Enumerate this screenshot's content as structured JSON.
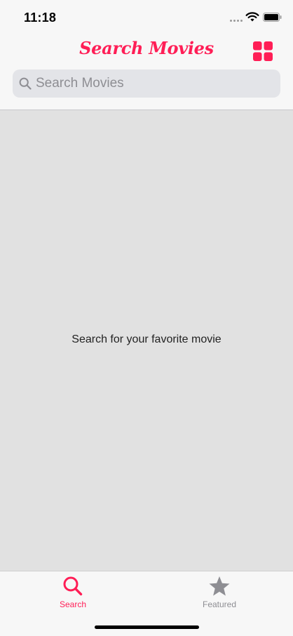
{
  "status_bar": {
    "time": "11:18"
  },
  "header": {
    "title": "Search Movies",
    "layout_icon": "grid-icon"
  },
  "search": {
    "placeholder": "Search Movies",
    "value": ""
  },
  "content": {
    "empty_message": "Search for your favorite movie"
  },
  "tab_bar": {
    "tabs": [
      {
        "label": "Search",
        "icon": "magnifying-glass-icon",
        "selected": true
      },
      {
        "label": "Featured",
        "icon": "star-icon",
        "selected": false
      }
    ]
  },
  "colors": {
    "accent": "#ff1e56",
    "content_background": "#e1e1e1",
    "inactive": "#8e8e93"
  }
}
